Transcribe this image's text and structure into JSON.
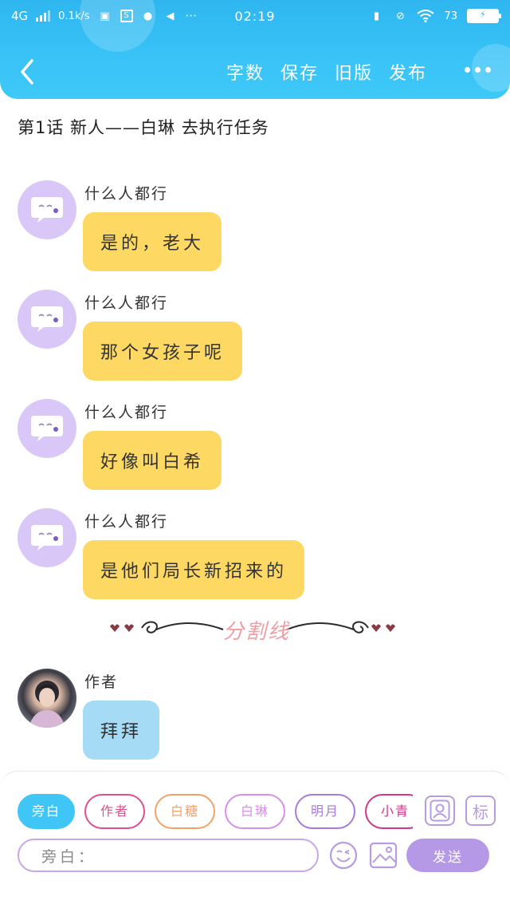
{
  "status_bar": {
    "network": "4G",
    "speed": "0.1k/s",
    "time": "02:19",
    "battery": "73",
    "more": "···"
  },
  "nav": {
    "actions": [
      "字数",
      "保存",
      "旧版",
      "发布"
    ]
  },
  "chapter_title": "第1话 新人——白琳 去执行任务",
  "messages": [
    {
      "sender": "什么人都行",
      "text": "是的，老大",
      "color": "#fdd863"
    },
    {
      "sender": "什么人都行",
      "text": "那个女孩子呢",
      "color": "#fdd863"
    },
    {
      "sender": "什么人都行",
      "text": "好像叫白希",
      "color": "#fdd863"
    },
    {
      "sender": "什么人都行",
      "text": "是他们局长新招来的",
      "color": "#fdd863"
    },
    {
      "sender": "作者",
      "text": "拜拜",
      "color": "#a6dbf6"
    }
  ],
  "divider_text": "分割线",
  "roles": [
    {
      "label": "旁白",
      "color": "#3fc6f6",
      "active": true
    },
    {
      "label": "作者",
      "color": "#e04e8c",
      "active": false
    },
    {
      "label": "白糖",
      "color": "#f0a26a",
      "active": false
    },
    {
      "label": "白琳",
      "color": "#d690e8",
      "active": false
    },
    {
      "label": "明月",
      "color": "#a77ad8",
      "active": false
    },
    {
      "label": "小青",
      "color": "#d2358a",
      "active": false
    }
  ],
  "side_icons": {
    "contact_icon": "contact-card-icon",
    "tag_label": "标"
  },
  "input": {
    "prefix": "旁白："
  },
  "send_label": "发送",
  "colors": {
    "header": "#39c3f7",
    "accent": "#b699e6",
    "default_avatar": "#d9c7f7"
  }
}
